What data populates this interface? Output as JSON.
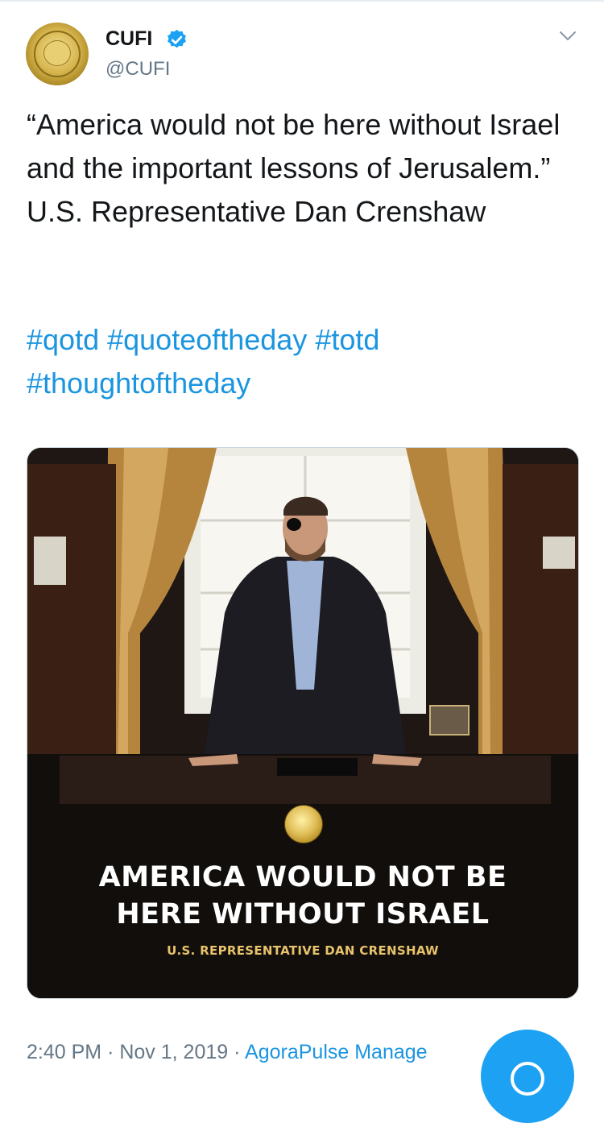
{
  "tweet": {
    "display_name": "CUFI",
    "handle": "@CUFI",
    "text": "“America would not be here without Israel and the important lessons of Jerusalem.” U.S. Representative Dan Crenshaw",
    "hashtags": [
      "#qotd",
      "#quoteoftheday",
      "#totd",
      "#thoughtoftheday"
    ],
    "media": {
      "headline_line1": "AMERICA WOULD NOT BE",
      "headline_line2": "HERE WITHOUT ISRAEL",
      "attribution": "U.S. REPRESENTATIVE DAN CRENSHAW"
    },
    "time": "2:40 PM",
    "date": "Nov 1, 2019",
    "separator": "·",
    "source": "AgoraPulse Manage"
  },
  "icons": {
    "verified": "verified-badge-icon",
    "more": "chevron-down-icon",
    "compose": "compose-fab-icon"
  },
  "colors": {
    "link": "#1b95e0",
    "muted": "#657786",
    "fab": "#1da1f2",
    "verified": "#1da1f2",
    "gold_text": "#e8c36a"
  }
}
